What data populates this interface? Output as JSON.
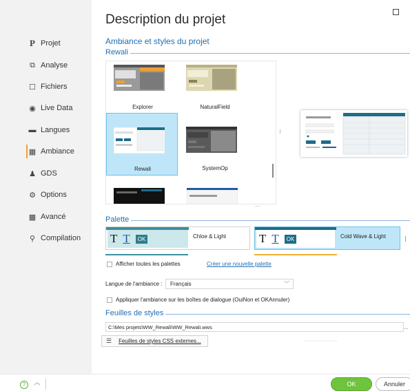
{
  "window": {
    "title": "Description du projet"
  },
  "sidebar": {
    "items": [
      {
        "label": "Projet",
        "icon": "P"
      },
      {
        "label": "Analyse",
        "icon": "⧉"
      },
      {
        "label": "Fichiers",
        "icon": "☐"
      },
      {
        "label": "Live Data",
        "icon": "◉"
      },
      {
        "label": "Langues",
        "icon": "▬"
      },
      {
        "label": "Ambiance",
        "icon": "▦"
      },
      {
        "label": "GDS",
        "icon": "♟"
      },
      {
        "label": "Options",
        "icon": "⚙"
      },
      {
        "label": "Avancé",
        "icon": "▩"
      },
      {
        "label": "Compilation",
        "icon": "⚲"
      }
    ],
    "active_index": 5
  },
  "main": {
    "section_title": "Ambiance et styles du projet",
    "themes_group": "Rewali",
    "themes": [
      {
        "name": "Explorer",
        "accent": "#f0a030",
        "bg": "#8a8a8a"
      },
      {
        "name": "NaturalField",
        "accent": "#c8c08a",
        "bg": "#dcd7b0"
      },
      {
        "name": "Rewali",
        "accent": "#1e7fa0",
        "bg": "#ffffff"
      },
      {
        "name": "SystemOp",
        "accent": "#333333",
        "bg": "#555555"
      }
    ],
    "selected_theme": "Rewali",
    "palette_group": "Palette",
    "palettes": [
      {
        "name": "Chloe & Light",
        "ok": "OK",
        "band": "#3a8fa0",
        "swatch_bg": "#cde8ea",
        "ok_bg": "#2e7d8c"
      },
      {
        "name": "Cold Wave & Light",
        "ok": "OK",
        "band": "#1e6d8a",
        "swatch_bg": "#ffffff",
        "ok_bg": "#1e6d8a"
      }
    ],
    "show_all_palettes": "Afficher toutes les palettes",
    "create_palette_link": "Créer une nouvelle palette",
    "language_label": "Langue de l'ambiance :",
    "language_value": "Français",
    "apply_dialogs": "Appliquer l'ambiance sur les boîtes de dialogue (OuiNon et OKAnnuler)",
    "stylesheets_group": "Feuilles de styles",
    "stylesheet_path": "C:\\Mes projets\\WW_Rewali\\WW_Rewali.wws",
    "external_css_button": "Feuilles de styles CSS externes...",
    "browse_dots": "..."
  },
  "footer": {
    "ok": "OK",
    "cancel": "Annuler",
    "help_icon": "?"
  }
}
